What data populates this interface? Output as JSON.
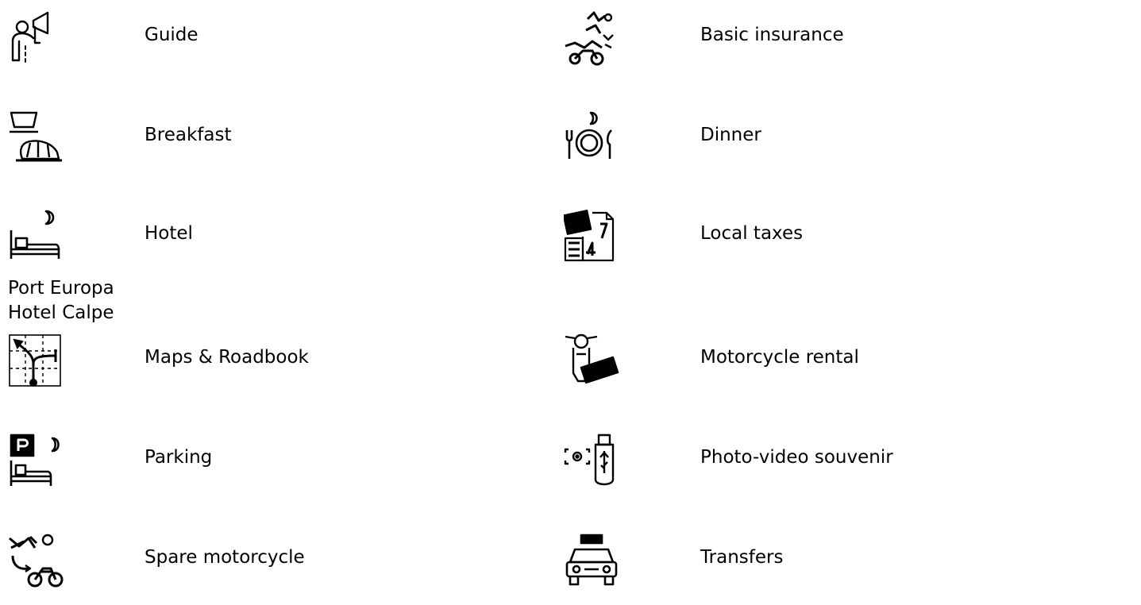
{
  "inclusions": {
    "left": [
      {
        "label": "Guide",
        "icon": "guide-megaphone-icon"
      },
      {
        "label": "Breakfast",
        "icon": "breakfast-cup-croissant-icon"
      },
      {
        "label": "Hotel",
        "icon": "hotel-bed-moon-icon",
        "detail": "Port Europa Hotel Calpe"
      },
      {
        "label": "Maps & Roadbook",
        "icon": "map-route-icon"
      },
      {
        "label": "Parking",
        "icon": "parking-bed-moon-icon"
      },
      {
        "label": "Spare motorcycle",
        "icon": "spare-motorcycle-icon"
      }
    ],
    "right": [
      {
        "label": "Basic insurance",
        "icon": "insurance-crash-icon"
      },
      {
        "label": "Dinner",
        "icon": "dinner-plate-cutlery-icon"
      },
      {
        "label": "Local taxes",
        "icon": "tax-included-icon"
      },
      {
        "label": "Motorcycle rental",
        "icon": "motorcycle-rental-icon"
      },
      {
        "label": "Photo-video souvenir",
        "icon": "usb-camera-icon"
      },
      {
        "label": "Transfers",
        "icon": "taxi-icon"
      }
    ]
  }
}
